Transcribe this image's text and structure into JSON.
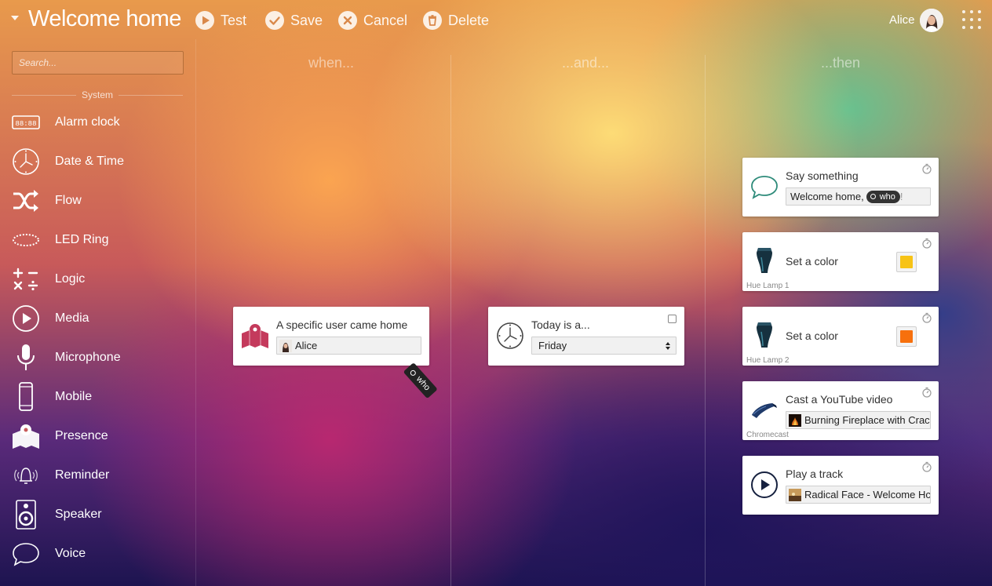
{
  "header": {
    "title": "Welcome home!",
    "buttons": {
      "test": "Test",
      "save": "Save",
      "cancel": "Cancel",
      "delete": "Delete"
    },
    "user": "Alice"
  },
  "sidebar": {
    "search_placeholder": "Search...",
    "section": "System",
    "items": [
      {
        "label": "Alarm clock",
        "icon": "alarm-clock-icon"
      },
      {
        "label": "Date & Time",
        "icon": "clock-icon"
      },
      {
        "label": "Flow",
        "icon": "shuffle-icon"
      },
      {
        "label": "LED Ring",
        "icon": "led-ring-icon"
      },
      {
        "label": "Logic",
        "icon": "math-operators-icon"
      },
      {
        "label": "Media",
        "icon": "play-icon"
      },
      {
        "label": "Microphone",
        "icon": "microphone-icon"
      },
      {
        "label": "Mobile",
        "icon": "smartphone-icon"
      },
      {
        "label": "Presence",
        "icon": "map-pin-icon"
      },
      {
        "label": "Reminder",
        "icon": "bell-icon"
      },
      {
        "label": "Speaker",
        "icon": "speaker-icon"
      },
      {
        "label": "Voice",
        "icon": "speech-bubble-icon"
      }
    ]
  },
  "columns": {
    "when": "when...",
    "and": "...and...",
    "then": "...then"
  },
  "when_card": {
    "title": "A specific user came home",
    "value": "Alice",
    "drag_tag": "who"
  },
  "and_card": {
    "title": "Today is a...",
    "selected": "Friday"
  },
  "then_cards": [
    {
      "title": "Say something",
      "text": "Welcome home, ",
      "tag": "who",
      "tail": "!"
    },
    {
      "title": "Set a color",
      "device": "Hue Lamp 1",
      "color": "#f7c316"
    },
    {
      "title": "Set a color",
      "device": "Hue Lamp 2",
      "color": "#f7700d"
    },
    {
      "title": "Cast a YouTube video",
      "device": "Chromecast",
      "value": "Burning Fireplace with Crac"
    },
    {
      "title": "Play a track",
      "value": "Radical Face - Welcome Hc"
    }
  ],
  "colors": {
    "accent_presence": "#c43a5c",
    "accent_speech": "#2e8b7a",
    "accent_chromecast": "#1f3a6a"
  }
}
